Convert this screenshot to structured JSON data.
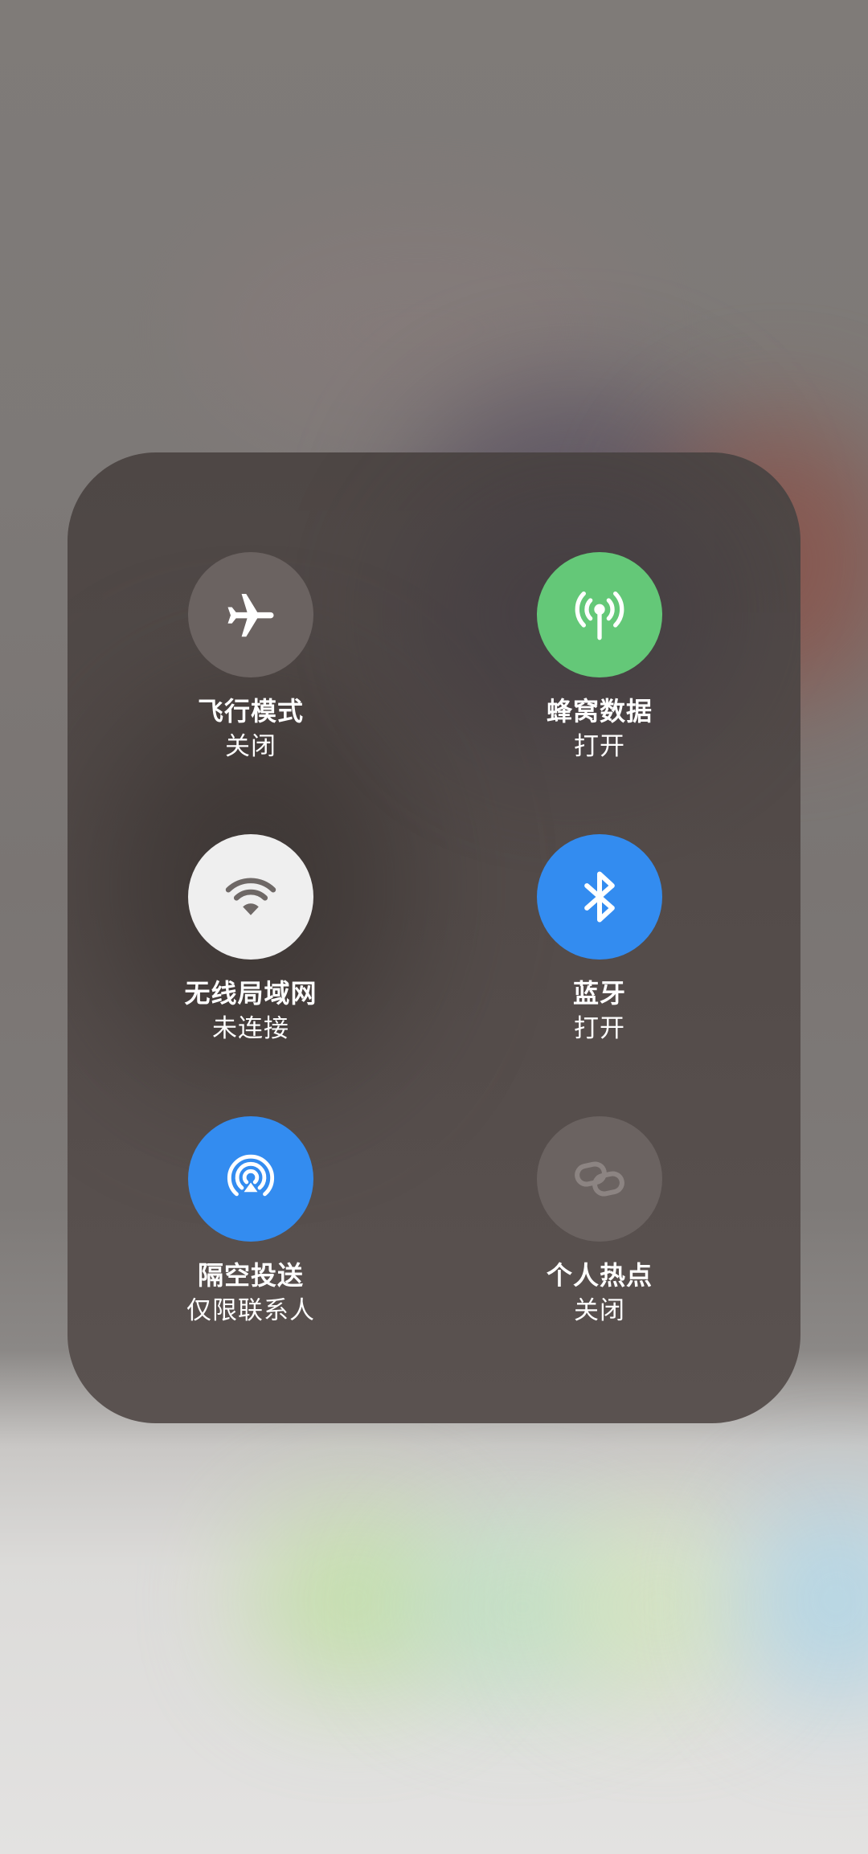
{
  "colors": {
    "off_button": "#6b6361",
    "cellular_on": "#64c878",
    "accent_blue": "#338cf0",
    "wifi_button": "#efefef",
    "label_text": "#ffffff"
  },
  "controls": [
    {
      "id": "airplane",
      "title": "飞行模式",
      "status": "关闭",
      "icon": "airplane-icon",
      "state": "off"
    },
    {
      "id": "cellular",
      "title": "蜂窝数据",
      "status": "打开",
      "icon": "antenna-icon",
      "state": "on"
    },
    {
      "id": "wifi",
      "title": "无线局域网",
      "status": "未连接",
      "icon": "wifi-icon",
      "state": "on-not-connected"
    },
    {
      "id": "bluetooth",
      "title": "蓝牙",
      "status": "打开",
      "icon": "bluetooth-icon",
      "state": "on"
    },
    {
      "id": "airdrop",
      "title": "隔空投送",
      "status": "仅限联系人",
      "icon": "airdrop-icon",
      "state": "on"
    },
    {
      "id": "hotspot",
      "title": "个人热点",
      "status": "关闭",
      "icon": "link-icon",
      "state": "off"
    }
  ]
}
